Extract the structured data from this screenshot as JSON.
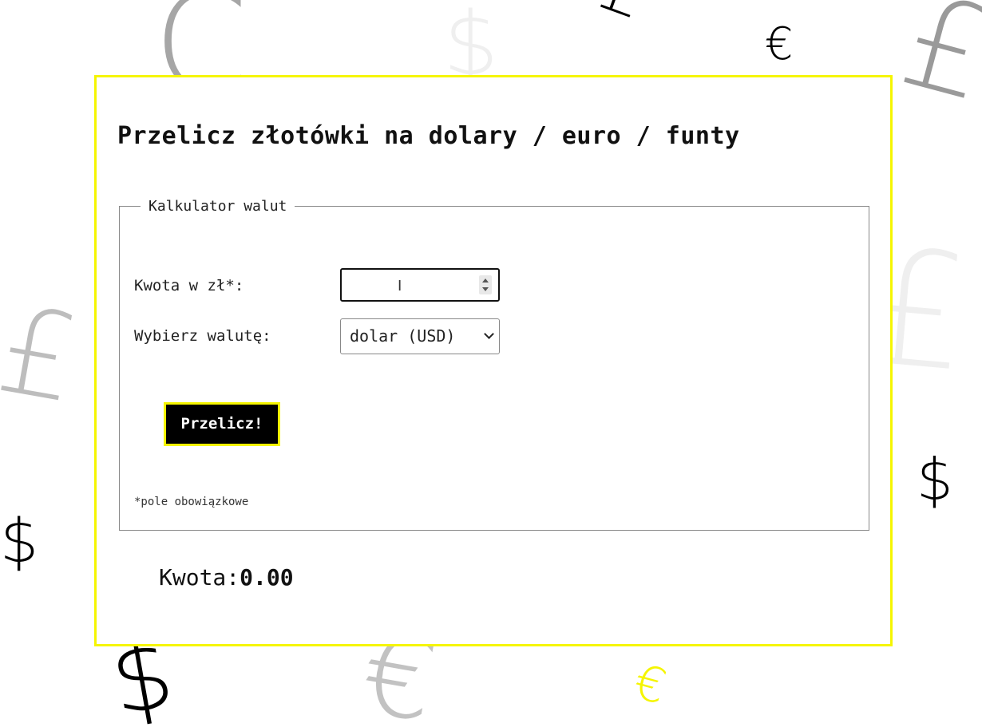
{
  "background": {
    "glyphs": [
      {
        "char": "C",
        "color": "#a6a6a6"
      },
      {
        "char": "$",
        "color": "#efefef"
      },
      {
        "char": "€",
        "color": "#000000"
      },
      {
        "char": "£",
        "color": "#000000"
      },
      {
        "char": "£",
        "color": "#9a9a9a"
      },
      {
        "char": "£",
        "color": "#bdbdbd"
      },
      {
        "char": "$",
        "color": "#000000"
      },
      {
        "char": "$",
        "color": "#000000"
      },
      {
        "char": "$",
        "color": "#000000"
      },
      {
        "char": "€",
        "color": "#c2c2c2"
      },
      {
        "char": "€",
        "color": "#f5f500"
      },
      {
        "char": "£",
        "color": "#efefef"
      }
    ]
  },
  "card": {
    "title": "Przelicz złotówki na dolary / euro / funty",
    "border_color": "#f5f500"
  },
  "calculator": {
    "legend": "Kalkulator walut",
    "amount_label": "Kwota w zł*:",
    "amount_value": "",
    "currency_label": "Wybierz walutę:",
    "currency_selected": "dolar (USD)",
    "submit_label": "Przelicz!",
    "required_note": "*pole obowiązkowe"
  },
  "result": {
    "label": "Kwota:",
    "value": "0.00"
  },
  "colors": {
    "accent": "#f5f500",
    "button_bg": "#000000",
    "button_text": "#ffffff"
  }
}
